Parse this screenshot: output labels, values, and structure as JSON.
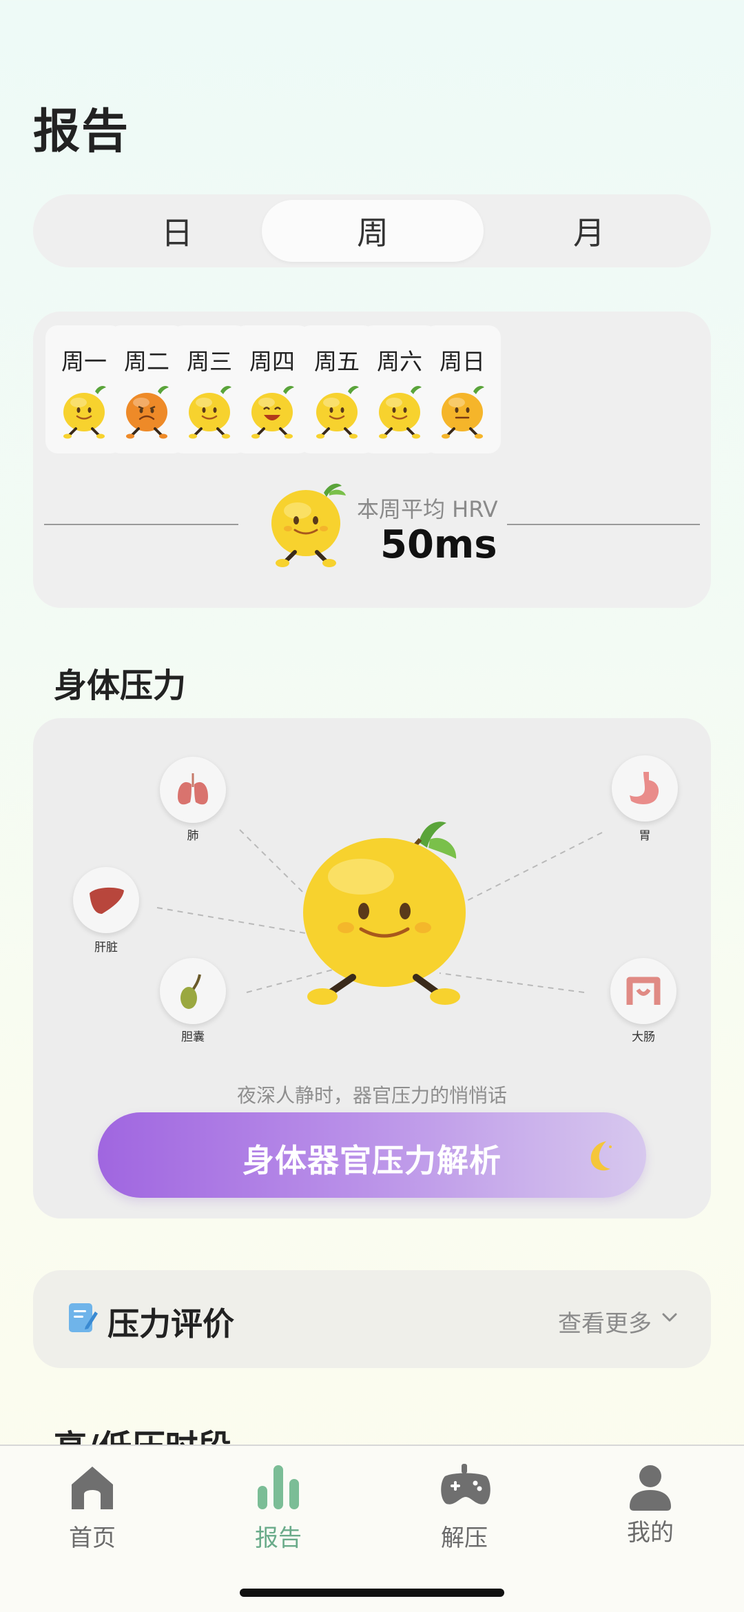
{
  "page": {
    "title": "报告"
  },
  "segment": {
    "items": [
      "日",
      "周",
      "月"
    ],
    "selected": "周"
  },
  "week": {
    "days": [
      {
        "label": "周一",
        "mood": "calm",
        "color": "#f7d22e"
      },
      {
        "label": "周二",
        "mood": "sad",
        "color": "#ee8a28"
      },
      {
        "label": "周三",
        "mood": "calm",
        "color": "#f7d22e"
      },
      {
        "label": "周四",
        "mood": "happy",
        "color": "#f7d22e"
      },
      {
        "label": "周五",
        "mood": "calm",
        "color": "#f7d22e"
      },
      {
        "label": "周六",
        "mood": "calm",
        "color": "#f7d22e"
      },
      {
        "label": "周日",
        "mood": "meh",
        "color": "#f5b52a"
      }
    ],
    "hrv_label": "本周平均 HRV",
    "hrv_value": "50ms"
  },
  "body_stress": {
    "title": "身体压力",
    "organs": [
      {
        "name": "肺",
        "icon": "lungs-icon"
      },
      {
        "name": "胃",
        "icon": "stomach-icon"
      },
      {
        "name": "肝脏",
        "icon": "liver-icon"
      },
      {
        "name": "胆囊",
        "icon": "gallbladder-icon"
      },
      {
        "name": "大肠",
        "icon": "intestine-icon"
      }
    ],
    "whisper": "夜深人静时，器官压力的悄悄话",
    "button_label": "身体器官压力解析"
  },
  "evaluation": {
    "title": "压力评价",
    "more": "查看更多"
  },
  "next_section": {
    "title": "高/低压时段"
  },
  "nav": {
    "items": [
      {
        "label": "首页",
        "icon": "home-icon"
      },
      {
        "label": "报告",
        "icon": "report-icon"
      },
      {
        "label": "解压",
        "icon": "gamepad-icon"
      },
      {
        "label": "我的",
        "icon": "profile-icon"
      }
    ],
    "active": "报告",
    "active_color": "#6aab8a"
  },
  "colors": {
    "accent_purple": "#a066e0",
    "mascot_yellow": "#f7d22e"
  }
}
